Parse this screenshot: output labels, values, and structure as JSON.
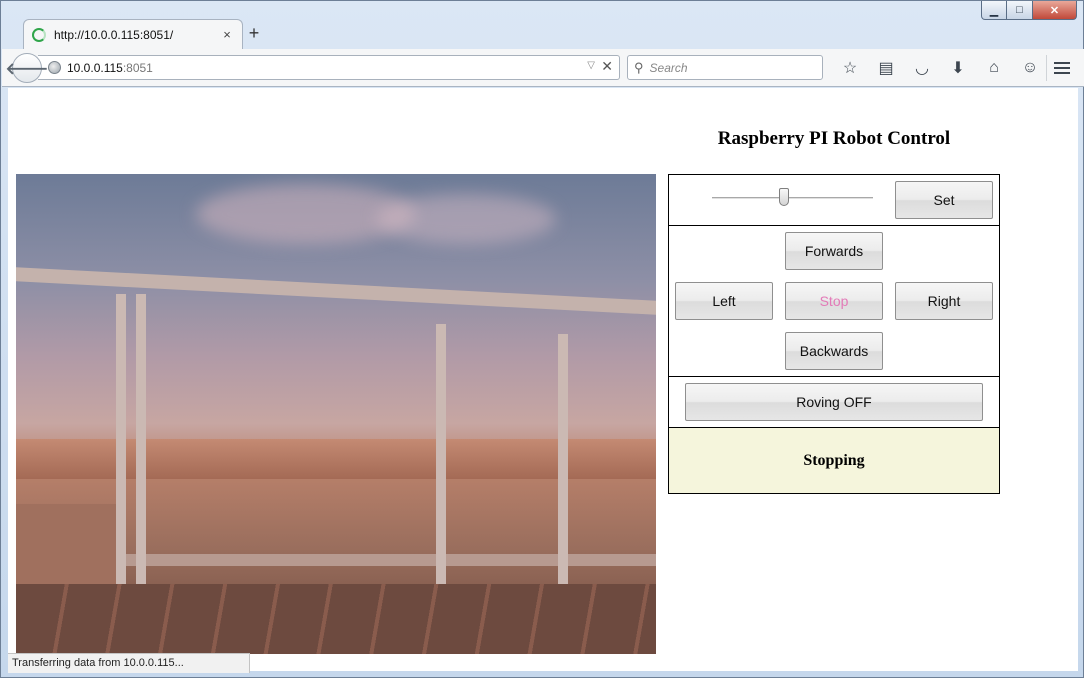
{
  "browser": {
    "tab_title": "http://10.0.0.115:8051/",
    "tab_close": "×",
    "new_tab": "+",
    "url_host": "10.0.0.115",
    "url_port": ":8051",
    "search_placeholder": "Search",
    "status_text": "Transferring data from 10.0.0.115..."
  },
  "window_controls": {
    "minimize": "▁",
    "maximize": "□",
    "close": "✕"
  },
  "page": {
    "title": "Raspberry PI Robot Control",
    "speed_slider_value": 0.45,
    "set_label": "Set",
    "forwards_label": "Forwards",
    "left_label": "Left",
    "stop_label": "Stop",
    "right_label": "Right",
    "backwards_label": "Backwards",
    "roving_label": "Roving OFF",
    "status": "Stopping",
    "status_bg": "#f5f5dc",
    "stop_color": "#e37bb8"
  },
  "icons": [
    "back-arrow-icon",
    "globe-icon",
    "dropdown-arrow-icon",
    "stop-load-icon",
    "search-icon",
    "bookmark-star-icon",
    "reading-list-icon",
    "pocket-icon",
    "download-icon",
    "home-icon",
    "chat-icon",
    "menu-icon"
  ]
}
